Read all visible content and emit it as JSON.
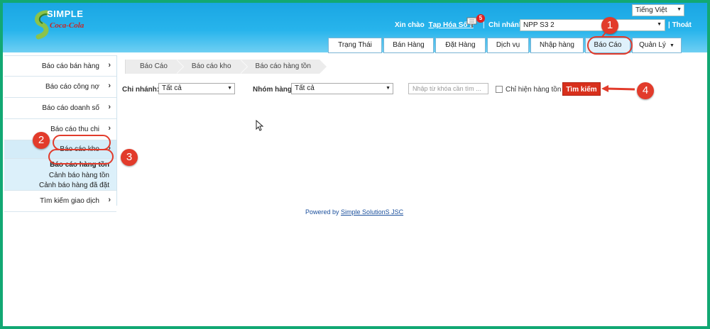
{
  "colors": {
    "header_bg": "#27b4ec",
    "frame": "#12a873",
    "accent_red": "#d8301c",
    "annotation": "#e23b2b"
  },
  "header": {
    "logo": {
      "top": "SIMPLE",
      "bottom": "Coca-Cola"
    },
    "language": "Tiếng Việt",
    "greeting": "Xin chào",
    "store_name": "Tạp Hóa Số 9",
    "notifications": "5",
    "separator": "|",
    "branch_label": "Chi nhánh:",
    "branch_value": "NPP S3 2",
    "logout": "| Thoát"
  },
  "tabs": [
    {
      "label": "Trạng Thái"
    },
    {
      "label": "Bán Hàng"
    },
    {
      "label": "Đặt Hàng"
    },
    {
      "label": "Dịch vụ"
    },
    {
      "label": "Nhập hàng"
    },
    {
      "label": "Báo Cáo"
    },
    {
      "label": "Quản Lý"
    }
  ],
  "sidebar": {
    "items": [
      {
        "label": "Báo cáo bán hàng"
      },
      {
        "label": "Báo cáo công nợ"
      },
      {
        "label": "Báo cáo doanh số"
      },
      {
        "label": "Báo cáo thu chi"
      },
      {
        "label": "Báo cáo kho"
      },
      {
        "label": "Tìm kiếm giao dịch"
      }
    ],
    "sub_items": [
      {
        "label": "Báo cáo hàng tồn"
      },
      {
        "label": "Cảnh báo hàng tồn"
      },
      {
        "label": "Cảnh báo hàng đã đặt"
      }
    ]
  },
  "breadcrumb": [
    "Báo Cáo",
    "Báo cáo kho",
    "Báo cáo hàng tồn"
  ],
  "filters": {
    "branch_label": "Chi nhánh:",
    "branch_value": "Tất cả",
    "group_label": "Nhóm hàng:",
    "group_value": "Tất cả",
    "keyword_placeholder": "Nhập từ khóa cần tìm ...",
    "only_stock_label": "Chỉ hiện hàng tồn",
    "search_button": "Tìm kiếm"
  },
  "footer": {
    "prefix": "Powered by",
    "link": "Simple SolutionS JSC"
  },
  "annotations": [
    "1",
    "2",
    "3",
    "4"
  ]
}
